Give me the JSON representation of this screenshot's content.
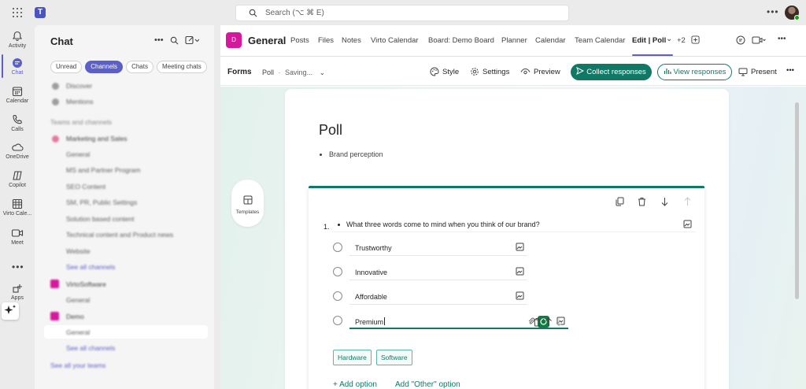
{
  "titlebar": {
    "search_placeholder": "Search (⌥ ⌘ E)",
    "more_icon": "more-horizontal-icon"
  },
  "rail": {
    "items": [
      {
        "label": "Activity",
        "icon": "bell-icon"
      },
      {
        "label": "Chat",
        "icon": "chat-icon"
      },
      {
        "label": "Calendar",
        "icon": "calendar-icon"
      },
      {
        "label": "Calls",
        "icon": "phone-icon"
      },
      {
        "label": "OneDrive",
        "icon": "cloud-icon"
      },
      {
        "label": "Copilot",
        "icon": "copilot-icon"
      },
      {
        "label": "Virto Cale...",
        "icon": "virto-calendar-icon"
      },
      {
        "label": "Meet",
        "icon": "video-icon"
      },
      {
        "label": "Apps",
        "icon": "apps-add-icon"
      }
    ],
    "active_color": "#5b5fc7"
  },
  "chatpanel": {
    "title": "Chat",
    "filters": [
      "Unread",
      "Channels",
      "Chats",
      "Meeting chats"
    ],
    "active_filter": "Channels",
    "rows": {
      "discover": "Discover",
      "mentions": "Mentions",
      "section": "Teams and channels",
      "team1": "Marketing and Sales",
      "team1_channels": [
        "General",
        "MS and Partner Program",
        "SEO Content",
        "SM, PR, Public Settings",
        "Solution based content",
        "Technical content and Product news",
        "Website"
      ],
      "team1_see_all": "See all channels",
      "team2": "VirtoSoftware",
      "team2_channels": [
        "General"
      ],
      "team3": "Demo",
      "team3_channels": [
        "General"
      ],
      "team3_see_all": "See all channels",
      "see_all_teams": "See all your teams"
    }
  },
  "channel": {
    "avatar_letter": "D",
    "name": "General",
    "tabs": [
      "Posts",
      "Files",
      "Notes",
      "Virto Calendar",
      "Board: Demo Board",
      "Planner",
      "Calendar",
      "Team Calendar",
      "Edit | Poll"
    ],
    "active_tab": "Edit | Poll",
    "more_tabs": "+2",
    "brand_color": "#d6189d"
  },
  "formsbar": {
    "app": "Forms",
    "form_name": "Poll",
    "status": "Saving...",
    "style_label": "Style",
    "settings_label": "Settings",
    "preview_label": "Preview",
    "collect_label": "Collect responses",
    "view_label": "View responses",
    "present_label": "Present",
    "accent": "#117865"
  },
  "form": {
    "templates_label": "Templates",
    "title": "Poll",
    "description": "Brand perception",
    "question": {
      "number": "1.",
      "text": "What three words come to mind when you think of our brand?",
      "options": [
        "Trustworthy",
        "Innovative",
        "Affordable",
        "Premium"
      ],
      "suggestions": [
        "Hardware",
        "Software"
      ],
      "add_option": "Add option",
      "add_other": "Add \"Other\" option"
    }
  }
}
